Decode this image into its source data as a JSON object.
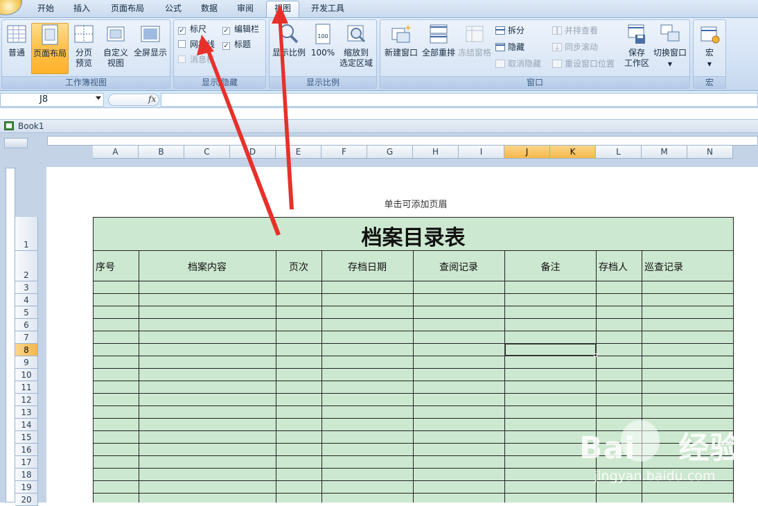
{
  "tabs": [
    {
      "label": "开始"
    },
    {
      "label": "插入"
    },
    {
      "label": "页面布局"
    },
    {
      "label": "公式"
    },
    {
      "label": "数据"
    },
    {
      "label": "审阅"
    },
    {
      "label": "视图"
    },
    {
      "label": "开发工具"
    }
  ],
  "active_tab": "视图",
  "groups": {
    "workbook_views": {
      "label": "工作簿视图",
      "normal": "普通",
      "page_layout": "页面布局",
      "page_break_1": "分页",
      "page_break_2": "预览",
      "custom_1": "自定义",
      "custom_2": "视图",
      "fullscreen": "全屏显示"
    },
    "show_hide": {
      "label": "显示/隐藏",
      "ruler": "标尺",
      "formula_bar": "编辑栏",
      "gridlines": "网格线",
      "headings": "标题",
      "message_bar": "消息栏",
      "ruler_checked": true,
      "formula_bar_checked": true,
      "gridlines_checked": false,
      "headings_checked": true,
      "message_bar_checked": false
    },
    "zoom": {
      "label": "显示比例",
      "zoom": "显示比例",
      "zoom100": "100%",
      "zoom_sel_1": "缩放到",
      "zoom_sel_2": "选定区域"
    },
    "window": {
      "label": "窗口",
      "new_window": "新建窗口",
      "arrange_all": "全部重排",
      "freeze": "冻结窗格",
      "split": "拆分",
      "hide": "隐藏",
      "unhide": "取消隐藏",
      "side_by_side": "并排查看",
      "sync_scroll": "同步滚动",
      "reset_pos": "重设窗口位置",
      "save_ws_1": "保存",
      "save_ws_2": "工作区",
      "switch": "切换窗口"
    },
    "macros": {
      "label": "宏",
      "macros": "宏"
    }
  },
  "formula_bar": {
    "name_box": "J8",
    "fx": "fx",
    "value": ""
  },
  "workbook_title": "Book1",
  "columns": [
    "A",
    "B",
    "C",
    "D",
    "E",
    "F",
    "G",
    "H",
    "I",
    "J",
    "K",
    "L",
    "M",
    "N"
  ],
  "selected_columns": [
    "J",
    "K"
  ],
  "rows": [
    "1",
    "2",
    "3",
    "4",
    "5",
    "6",
    "7",
    "8",
    "9",
    "10",
    "11",
    "12",
    "13",
    "14",
    "15",
    "16",
    "17",
    "18",
    "19",
    "20"
  ],
  "selected_row": "8",
  "page_header_hint": "单击可添加页眉",
  "sheet": {
    "title": "档案目录表",
    "headers": [
      "序号",
      "档案内容",
      "页次",
      "存档日期",
      "查阅记录",
      "备注",
      "存档人",
      "巡查记录"
    ],
    "active_cell": "J8"
  },
  "watermark": {
    "brand": "Bai",
    "brand2": "经验",
    "url": "jingyan.baidu.com"
  },
  "colors": {
    "table_fill": "#cde8d0",
    "selection": "#f6b84a",
    "arrow": "#e8302a"
  }
}
